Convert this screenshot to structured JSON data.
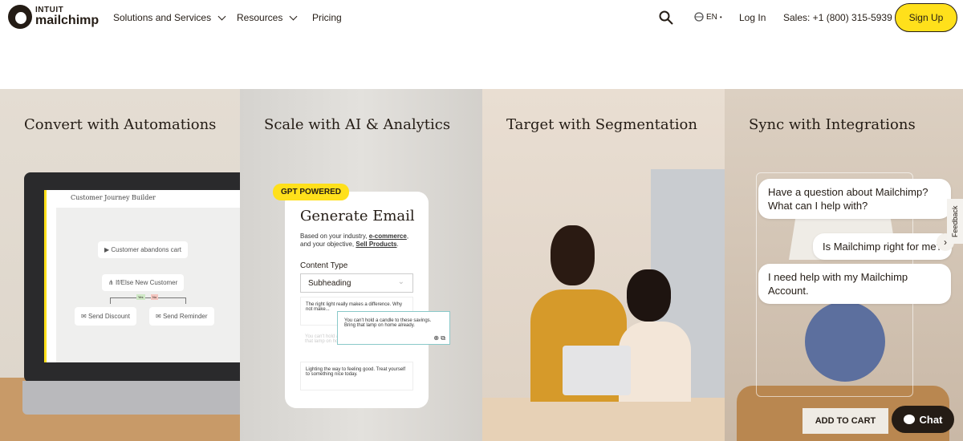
{
  "nav": {
    "logo_top": "INTUIT",
    "logo_bottom": "mailchimp",
    "items": [
      {
        "label": "Solutions and Services"
      },
      {
        "label": "Resources"
      },
      {
        "label": "Pricing"
      }
    ],
    "lang": "EN",
    "login": "Log In",
    "sales": "Sales: +1 (800) 315-5939",
    "signup": "Sign Up"
  },
  "panels": [
    {
      "title": "Convert with Automations",
      "app_title": "Customer Journey Builder",
      "nodes": [
        "Customer abandons cart",
        "If/Else New Customer",
        "Send Discount",
        "Send Reminder"
      ],
      "yes": "Yes",
      "no": "No"
    },
    {
      "title": "Scale with AI & Analytics",
      "badge": "GPT POWERED",
      "card_title": "Generate Email",
      "desc1": "Based on your industry, ",
      "link1": "e-commerce",
      "desc2": ", and your objective, ",
      "link2": "Sell Products",
      "desc3": ".",
      "content_type_label": "Content Type",
      "select_value": "Subheading",
      "options": [
        "The right light really makes a difference. Why not make...",
        "You can't hold a candle to these savings. Bring that lamp on home already.",
        "Lighting the way to feeling good. Treat yourself to something nice today."
      ],
      "popup": "You can't hold a candle to these savings. Bring that lamp on home already."
    },
    {
      "title": "Target with Segmentation"
    },
    {
      "title": "Sync with Integrations",
      "chat_msgs": [
        "Have a question about Mailchimp? What can I help with?",
        "Is Mailchimp right for me?",
        "I need help with my Mailchimp Account."
      ],
      "add_to_cart": "ADD TO CART",
      "chat": "Chat",
      "feedback": "Feedback"
    }
  ],
  "colors": {
    "brand_yellow": "#ffe01b",
    "text": "#241c15"
  }
}
